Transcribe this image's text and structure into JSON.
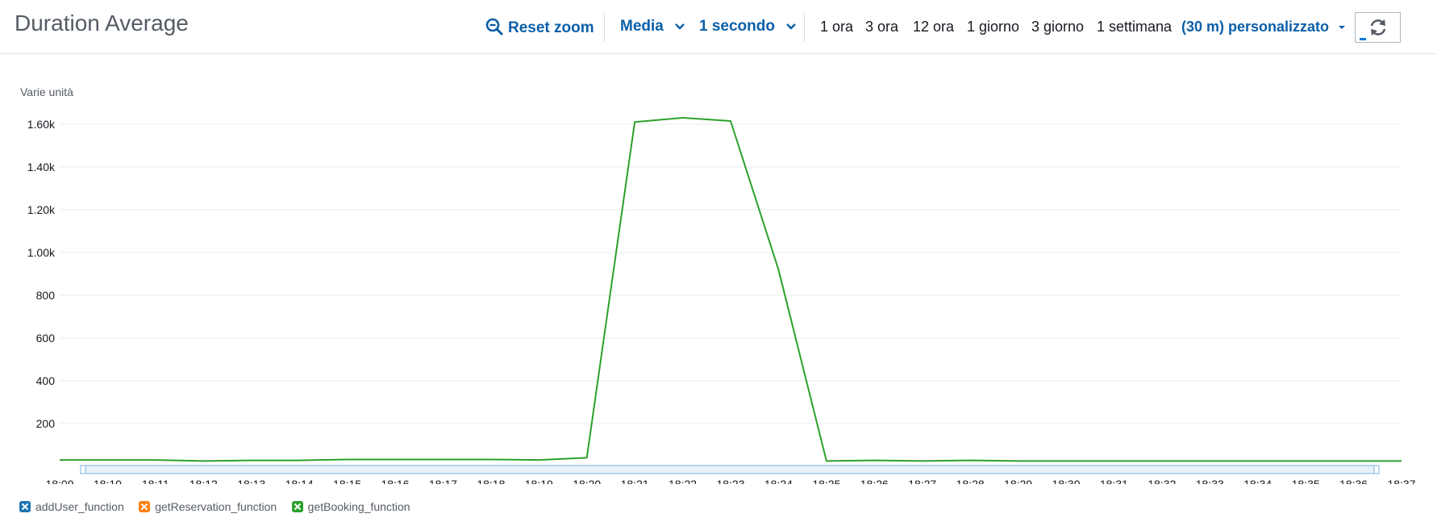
{
  "header": {
    "title": "Duration Average",
    "reset_zoom": "Reset zoom",
    "statistic": "Media",
    "period": "1 secondo",
    "ranges": [
      "1 ora",
      "3 ora",
      "12 ora",
      "1 giorno",
      "3 giorno",
      "1 settimana"
    ],
    "custom_range": "(30 m) personalizzato"
  },
  "colors": {
    "accent": "#0b5fa8",
    "addUser_function": "#1f77b4",
    "getReservation_function": "#ff7f0e",
    "getBooking_function": "#2ca02c"
  },
  "icons": [
    "zoom-out-icon",
    "chevron-down-icon",
    "caret-down-icon",
    "refresh-icon"
  ],
  "chart_data": {
    "type": "line",
    "ylabel": "Varie unità",
    "xlabel": "",
    "ylim": [
      0,
      1600
    ],
    "yticks": [
      200,
      400,
      600,
      800,
      1000,
      1200,
      1400,
      1600
    ],
    "ytick_labels": [
      "200",
      "400",
      "600",
      "800",
      "1.00k",
      "1.20k",
      "1.40k",
      "1.60k"
    ],
    "x": [
      "18:09",
      "18:10",
      "18:11",
      "18:12",
      "18:13",
      "18:14",
      "18:15",
      "18:16",
      "18:17",
      "18:18",
      "18:19",
      "18:20",
      "18:21",
      "18:22",
      "18:23",
      "18:24",
      "18:25",
      "18:26",
      "18:27",
      "18:28",
      "18:29",
      "18:30",
      "18:31",
      "18:32",
      "18:33",
      "18:34",
      "18:35",
      "18:36",
      "18:37"
    ],
    "series": [
      {
        "name": "addUser_function",
        "color": "#1f77b4",
        "values": []
      },
      {
        "name": "getReservation_function",
        "color": "#ff7f0e",
        "values": []
      },
      {
        "name": "getBooking_function",
        "color": "#2ca02c",
        "values": [
          30,
          30,
          30,
          25,
          28,
          28,
          32,
          32,
          32,
          32,
          30,
          40,
          1610,
          1630,
          1615,
          920,
          25,
          28,
          25,
          28,
          25,
          25,
          25,
          25,
          25,
          25,
          25,
          25,
          25
        ]
      }
    ],
    "grid": true,
    "legend": "bottom-left"
  }
}
